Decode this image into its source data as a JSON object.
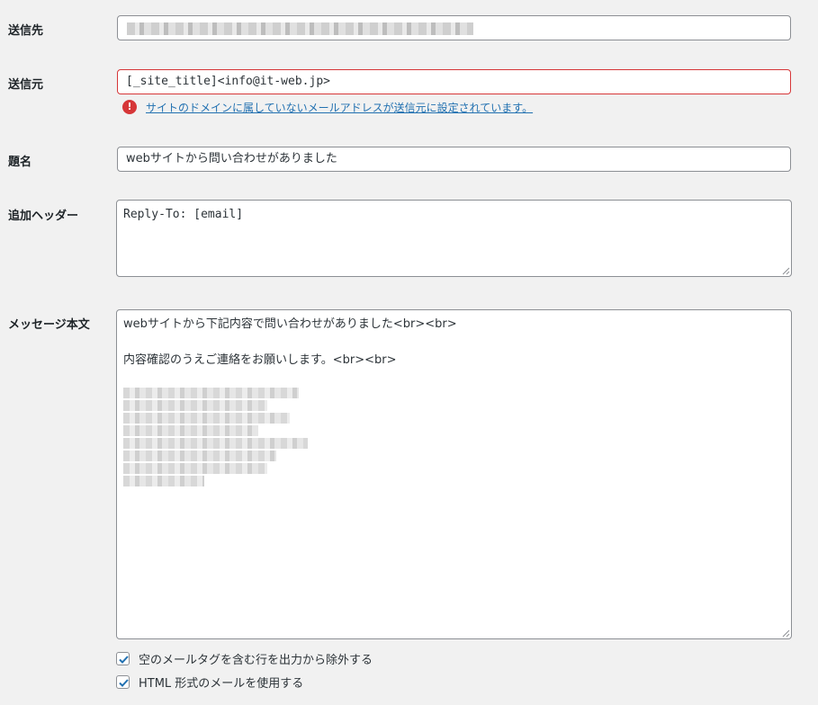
{
  "fields": {
    "to": {
      "label": "送信先"
    },
    "from": {
      "label": "送信元",
      "value": "[_site_title]<info@it-web.jp>",
      "error_message": "サイトのドメインに属していないメールアドレスが送信元に設定されています。"
    },
    "subject": {
      "label": "題名",
      "value": "webサイトから問い合わせがありました"
    },
    "headers": {
      "label": "追加ヘッダー",
      "value": "Reply-To: [email]"
    },
    "body": {
      "label": "メッセージ本文",
      "line1": "webサイトから下記内容で問い合わせがありました<br><br>",
      "line2": "内容確認のうえご連絡をお願いします。<br><br>"
    }
  },
  "options": {
    "exclude_blank": "空のメールタグを含む行を出力から除外する",
    "use_html": "HTML 形式のメールを使用する"
  },
  "colors": {
    "error": "#d63638",
    "link": "#2271b1",
    "checkbox": "#2271b1"
  }
}
